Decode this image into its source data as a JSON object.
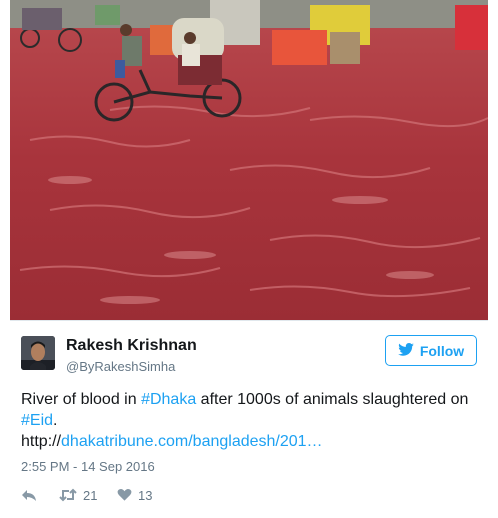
{
  "tweet": {
    "author_name": "Rakesh Krishnan",
    "author_handle": "@ByRakeshSimha",
    "follow_label": "Follow",
    "text_1": "River of blood in ",
    "hashtag_1": "#Dhaka",
    "text_2": " after 1000s of animals slaughtered on ",
    "hashtag_2": "#Eid",
    "text_3": ".",
    "link": "http://dhakatribune.com/bangladesh/201…",
    "timestamp": "2:55 PM - 14 Sep 2016",
    "retweet_count": "21",
    "like_count": "13"
  },
  "colors": {
    "brand_blue": "#1da1f2",
    "secondary_text": "#657786",
    "flood_red": "#a8343c"
  },
  "icons": [
    "twitter-bird-icon",
    "reply-icon",
    "retweet-icon",
    "heart-icon"
  ]
}
